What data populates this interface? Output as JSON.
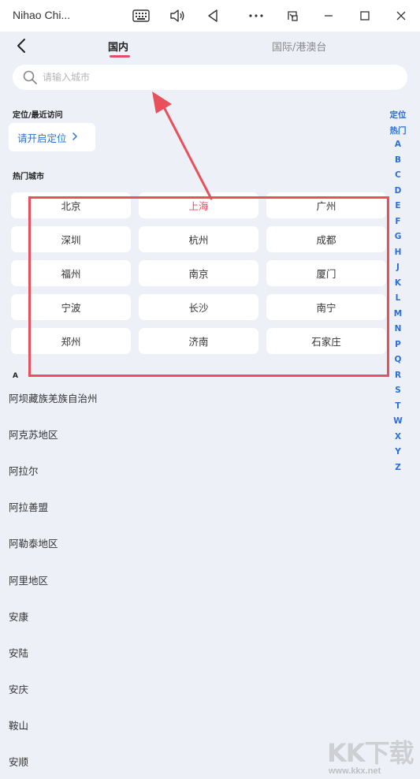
{
  "window": {
    "title": "Nihao Chi...",
    "icons": [
      "keyboard-icon",
      "volume-icon",
      "back-triangle-icon",
      "more-icon",
      "screen-rotate-icon",
      "minimize-icon",
      "maximize-icon",
      "close-icon"
    ]
  },
  "header": {
    "tabs": [
      {
        "label": "国内",
        "active": true
      },
      {
        "label": "国际/港澳台",
        "active": false
      }
    ],
    "accent_color": "#e84a5f"
  },
  "search": {
    "placeholder": "请输入城市",
    "value": ""
  },
  "location": {
    "section_title": "定位/最近访问",
    "button_label": "请开启定位"
  },
  "hot": {
    "section_title": "热门城市",
    "cities": [
      "北京",
      "上海",
      "广州",
      "深圳",
      "杭州",
      "成都",
      "福州",
      "南京",
      "厦门",
      "宁波",
      "长沙",
      "南宁",
      "郑州",
      "济南",
      "石家庄"
    ],
    "highlighted": "上海"
  },
  "index": {
    "items": [
      "定位",
      "热门",
      "A",
      "B",
      "C",
      "D",
      "E",
      "F",
      "G",
      "H",
      "J",
      "K",
      "L",
      "M",
      "N",
      "P",
      "Q",
      "R",
      "S",
      "T",
      "W",
      "X",
      "Y",
      "Z"
    ],
    "color": "#2b6fd8"
  },
  "city_list": {
    "letter": "A",
    "items": [
      "阿坝藏族羌族自治州",
      "阿克苏地区",
      "阿拉尔",
      "阿拉善盟",
      "阿勒泰地区",
      "阿里地区",
      "安康",
      "安陆",
      "安庆",
      "鞍山",
      "安顺"
    ]
  },
  "watermark": {
    "big": "KK下载",
    "small": "www.kkx.net"
  }
}
